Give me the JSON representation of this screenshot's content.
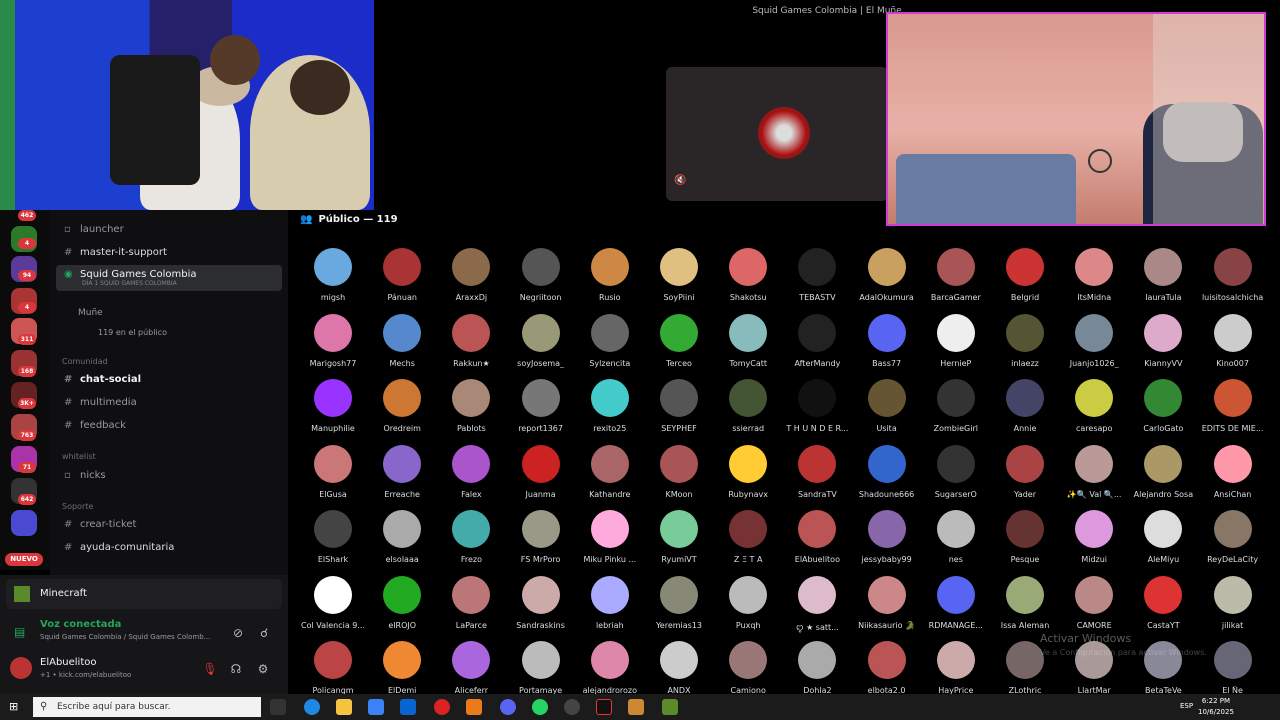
{
  "window": {
    "title": "Squid Games Colombia | El Muñe"
  },
  "servers": {
    "badges": [
      "462",
      "4",
      "94",
      "4",
      "311",
      "168",
      "3K+",
      "763",
      "71",
      "642"
    ],
    "nuevo": "NUEVO"
  },
  "channels": {
    "items": [
      {
        "label": "launcher",
        "type": "voice-text"
      },
      {
        "label": "master-it-support",
        "type": "text"
      },
      {
        "label": "chat-social",
        "type": "text"
      },
      {
        "label": "multimedia",
        "type": "text"
      },
      {
        "label": "feedback",
        "type": "text"
      },
      {
        "label": "nicks",
        "type": "voice-text"
      },
      {
        "label": "crear-ticket",
        "type": "text"
      },
      {
        "label": "ayuda-comunitaria",
        "type": "text"
      }
    ],
    "active": {
      "label": "Squid Games Colombia",
      "sub": "DÍA 1 SQUID GAMES COLOMBIA",
      "speaker": "Muñe",
      "audience": "119 en el público"
    },
    "categories": [
      "Comunidad",
      "whitelist",
      "Soporte"
    ]
  },
  "panel": {
    "activity": "Minecraft",
    "voice_status": "Voz conectada",
    "voice_channel": "Squid Games Colombia / Squid Games Colomb...",
    "user_name": "ElAbuelitoo",
    "user_sub": "+1 • kick.com/elabuelitoo"
  },
  "stage": {
    "audience_label": "Público — 119"
  },
  "audience": [
    "migsh",
    "Pánuan",
    "AraxxDj",
    "Negriitoon",
    "Rusio",
    "SoyPiini",
    "Shakotsu",
    "TEBASTV",
    "AdalOkumura",
    "BarcaGamer",
    "Belgrid",
    "ItsMidna",
    "lauraTula",
    "luisitosalchicha",
    "Marigosh77",
    "Mechs",
    "Rakkun★",
    "soyJosema_",
    "Sylzencita",
    "Terceo",
    "TomyCatt",
    "AfterMandy",
    "Bass77",
    "HernieP",
    "inlaezz",
    "Juanjo1026_",
    "KiannyVV",
    "Kino007",
    "Manuphilie",
    "Oredreim",
    "Pablots",
    "report1367",
    "rexito25",
    "SEYPHEF",
    "ssierrad",
    "T H U N D E R...",
    "Usita",
    "ZombieGirl",
    "Annie",
    "caresapo",
    "CarloGato",
    "EDITS DE MIE...",
    "ElGusa",
    "Erreache",
    "Falex",
    "Juanma",
    "Kathandre",
    "KMoon",
    "Rubynavx",
    "SandraTV",
    "Shadoune666",
    "SugarserO",
    "Yader",
    "✨🔍 Val 🔍...",
    "Alejandro Sosa",
    "AnsiChan",
    "ElShark",
    "elsolaaa",
    "Frezo",
    "FS MrPoro",
    "Miku Pinku ...",
    "RyumiVT",
    "Z Ξ T A",
    "ElAbuelitoo",
    "jessybaby99",
    "nes",
    "Pesque",
    "Midzui",
    "AleMiyu",
    "ReyDeLaCity",
    "Col Valencia 9...",
    "elROJO",
    "LaParce",
    "Sandraskins",
    "lebriah",
    "Yeremias13",
    "Puxqh",
    "ꨄ ★ satt...",
    "Niikasaurio 🐊",
    "RDMANAGE...",
    "Issa Aleman",
    "CAMORE",
    "CastaYT",
    "jilikat",
    "Policangm",
    "ElDemi",
    "Aliceferr",
    "Portamaye",
    "alejandrorozo",
    "ANDX",
    "Camiono",
    "Dohla2",
    "elbota2.0",
    "HayPrice",
    "ZLothric",
    "LlartMar",
    "BetaTeVe",
    "El Ñe"
  ],
  "audience_colors": [
    "#6aa8e0",
    "#a33",
    "#8a6a4a",
    "#555",
    "#c84",
    "#e0c080",
    "#d66",
    "#222",
    "#c9a060",
    "#a55",
    "#c33",
    "#d88",
    "#aa8888",
    "#844",
    "#d7a",
    "#58c",
    "#b55",
    "#997",
    "#666",
    "#3a3",
    "#8bb",
    "#222",
    "#5865f2",
    "#eee",
    "#553",
    "#789",
    "#dac",
    "#ccc",
    "#93f",
    "#c73",
    "#a87",
    "#777",
    "#4cc",
    "#555",
    "#453",
    "#111",
    "#653",
    "#333",
    "#446",
    "#cc4",
    "#383",
    "#c53",
    "#c77",
    "#86c",
    "#a5c",
    "#c22",
    "#a66",
    "#a55",
    "#fc3",
    "#b33",
    "#36c",
    "#333",
    "#a44",
    "#b99",
    "#a96",
    "#f9a",
    "#444",
    "#aaa",
    "#4aa",
    "#998",
    "#fad",
    "#7c9",
    "#733",
    "#b55",
    "#86a",
    "#bbb",
    "#633",
    "#d9d",
    "#ddd",
    "#876",
    "#fff",
    "#2a2",
    "#b77",
    "#caa",
    "#aaf",
    "#887",
    "#bbb",
    "#dbc",
    "#c88",
    "#5865f2",
    "#9a7",
    "#b88",
    "#d33",
    "#bba",
    "#b44",
    "#e83",
    "#a6d",
    "#bbb",
    "#d8a",
    "#ccc",
    "#977",
    "#aaa",
    "#b55",
    "#caa",
    "#766",
    "#a99",
    "#889",
    "#667"
  ],
  "watermark": {
    "title": "Activar Windows",
    "sub": "Ve a Configuración para activar Windows."
  },
  "taskbar": {
    "search_placeholder": "Escribe aquí para buscar.",
    "lang": "ESP",
    "time": "6:22 PM",
    "date": "10/6/2025"
  }
}
